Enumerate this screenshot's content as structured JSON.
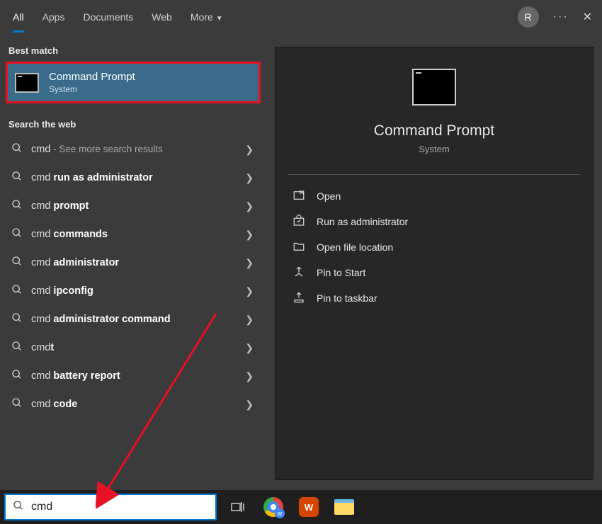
{
  "tabs": {
    "items": [
      "All",
      "Apps",
      "Documents",
      "Web",
      "More"
    ],
    "active": 0
  },
  "avatar_letter": "R",
  "best_match": {
    "heading": "Best match",
    "title": "Command Prompt",
    "subtitle": "System"
  },
  "web": {
    "heading": "Search the web",
    "items": [
      {
        "prefix": "cmd",
        "bold": "",
        "suffix": " - See more search results",
        "suffix_sub": true
      },
      {
        "prefix": "cmd ",
        "bold": "run as administrator",
        "suffix": ""
      },
      {
        "prefix": "cmd ",
        "bold": "prompt",
        "suffix": ""
      },
      {
        "prefix": "cmd ",
        "bold": "commands",
        "suffix": ""
      },
      {
        "prefix": "cmd ",
        "bold": "administrator",
        "suffix": ""
      },
      {
        "prefix": "cmd ",
        "bold": "ipconfig",
        "suffix": ""
      },
      {
        "prefix": "cmd ",
        "bold": "administrator command",
        "suffix": ""
      },
      {
        "prefix": "cmd",
        "bold": "t",
        "suffix": ""
      },
      {
        "prefix": "cmd ",
        "bold": "battery report",
        "suffix": ""
      },
      {
        "prefix": "cmd ",
        "bold": "code",
        "suffix": ""
      }
    ]
  },
  "preview": {
    "title": "Command Prompt",
    "subtitle": "System",
    "actions": [
      "Open",
      "Run as administrator",
      "Open file location",
      "Pin to Start",
      "Pin to taskbar"
    ]
  },
  "search_value": "cmd"
}
